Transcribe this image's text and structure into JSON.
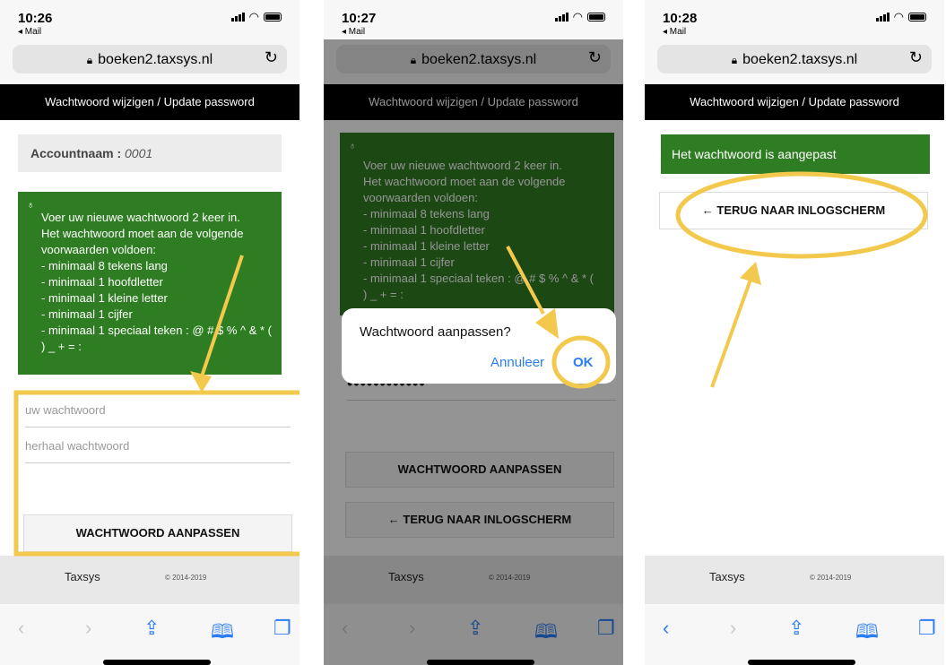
{
  "colors": {
    "success_green": "#2f7d22",
    "header_black": "#000000",
    "ios_blue": "#2a7df4",
    "highlight_yellow": "#f2c94c"
  },
  "common": {
    "back_label": "◂ Mail",
    "url": "boeken2.taxsys.nl",
    "header_title": "Wachtwoord wijzigen / Update password",
    "footer_brand": "Taxsys",
    "footer_copyright": "© 2014-2019",
    "icons": {
      "lock": "lock-icon",
      "reload": "reload-icon",
      "share": "share-icon",
      "bookmarks": "bookmarks-icon",
      "tabs": "tabs-icon"
    }
  },
  "instructions": {
    "lines": [
      "Voer uw nieuwe wachtwoord 2 keer in.",
      "Het wachtwoord moet aan de volgende",
      "voorwaarden voldoen:",
      "- minimaal 8 tekens lang",
      "- minimaal 1 hoofdletter",
      "- minimaal 1 kleine letter",
      "- minimaal 1 cijfer",
      "- minimaal 1 speciaal teken : @ # $ % ^ & * (",
      ") _ + = :"
    ]
  },
  "screens": [
    {
      "time": "10:26",
      "account_label": "Accountnaam :",
      "account_value": "0001",
      "password_placeholder": "uw wachtwoord",
      "repeat_placeholder": "herhaal wachtwoord",
      "submit_label": "WACHTWOORD AANPASSEN"
    },
    {
      "time": "10:27",
      "password_dots": "••••••••••••",
      "submit_label": "WACHTWOORD AANPASSEN",
      "back_button": "← TERUG NAAR INLOGSCHERM",
      "dialog": {
        "title": "Wachtwoord aanpassen?",
        "cancel": "Annuleer",
        "ok": "OK"
      }
    },
    {
      "time": "10:28",
      "success_message": "Het wachtwoord is aangepast",
      "back_button": "← TERUG NAAR INLOGSCHERM"
    }
  ]
}
